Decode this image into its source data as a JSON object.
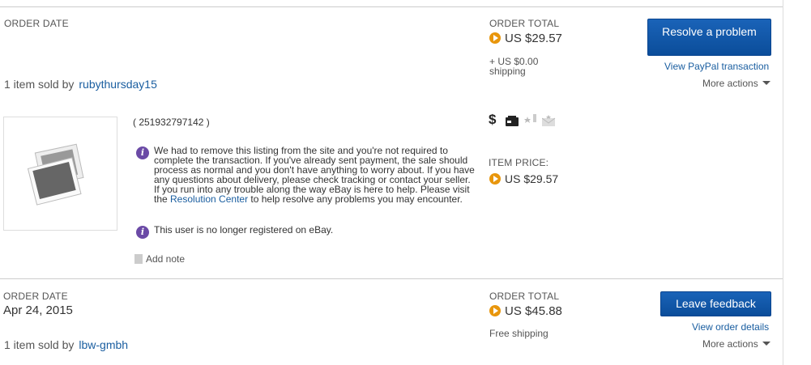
{
  "order1": {
    "date_label": "ORDER DATE",
    "sold_prefix": "1 item sold by",
    "seller": "rubythursday15",
    "total_label": "ORDER TOTAL",
    "total": "US $29.57",
    "shipping_line1": "+ US $0.00",
    "shipping_line2": "shipping",
    "primary_button": "Resolve a problem",
    "secondary_link": "View PayPal transaction",
    "more_actions": "More actions",
    "item_number": "( 251932797142 )",
    "notice_text_before_link": "We had to remove this listing from the site and you're not required to complete the transaction. If you've already sent payment, the sale should process as normal and you don't have anything to worry about. If you have any questions about delivery, please check tracking or contact your seller. If you run into any trouble along the way eBay is here to help. Please visit the ",
    "notice_link": "Resolution Center",
    "notice_text_after_link": " to help resolve any problems you may encounter.",
    "user_notice": "This user is no longer registered on eBay.",
    "add_note": "Add note",
    "item_price_label": "ITEM PRICE:",
    "item_price": "US $29.57",
    "status_icons": [
      "dollar-icon",
      "delivery-icon",
      "feedback-left-icon",
      "feedback-received-icon"
    ]
  },
  "order2": {
    "date_label": "ORDER DATE",
    "date": "Apr 24, 2015",
    "sold_prefix": "1 item sold by",
    "seller": "lbw-gmbh",
    "total_label": "ORDER TOTAL",
    "total": "US $45.88",
    "shipping": "Free shipping",
    "primary_button": "Leave feedback",
    "secondary_link": "View order details",
    "more_actions": "More actions"
  },
  "colors": {
    "accent": "#0b4d9a",
    "link": "#1a5ea0",
    "coin": "#e8960c",
    "info": "#6b4aa6"
  }
}
